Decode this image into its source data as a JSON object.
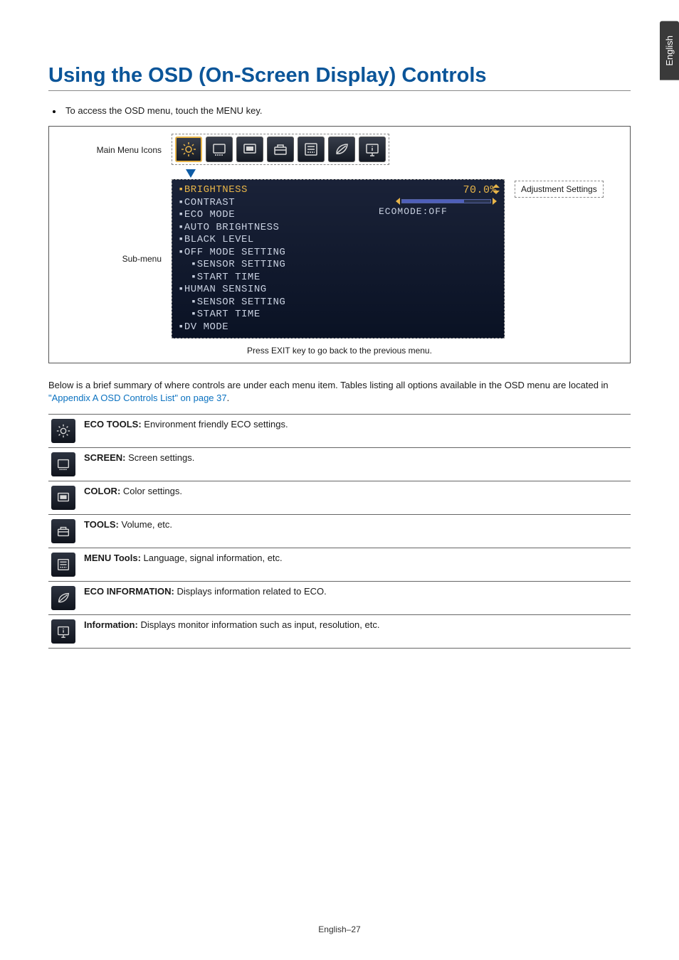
{
  "language_tab": "English",
  "page_title": "Using the OSD (On-Screen Display) Controls",
  "intro_bullet": "To access the OSD menu, touch the MENU key.",
  "diagram": {
    "main_icons_label": "Main Menu Icons",
    "sub_menu_label": "Sub-menu",
    "adjustment_label": "Adjustment Settings",
    "exit_text": "Press EXIT key to go back to the previous menu.",
    "brightness_value": "70.0%",
    "ecomode_text": "ECOMODE:OFF",
    "items": [
      {
        "text": "BRIGHTNESS",
        "indent": 0,
        "selected": true
      },
      {
        "text": "CONTRAST",
        "indent": 0,
        "selected": false
      },
      {
        "text": "ECO MODE",
        "indent": 0,
        "selected": false
      },
      {
        "text": "AUTO BRIGHTNESS",
        "indent": 0,
        "selected": false
      },
      {
        "text": "BLACK LEVEL",
        "indent": 0,
        "selected": false
      },
      {
        "text": "OFF MODE SETTING",
        "indent": 0,
        "selected": false
      },
      {
        "text": "SENSOR SETTING",
        "indent": 1,
        "selected": false
      },
      {
        "text": "START TIME",
        "indent": 1,
        "selected": false
      },
      {
        "text": "HUMAN SENSING",
        "indent": 0,
        "selected": false
      },
      {
        "text": "SENSOR SETTING",
        "indent": 1,
        "selected": false
      },
      {
        "text": "START TIME",
        "indent": 1,
        "selected": false
      },
      {
        "text": "DV MODE",
        "indent": 0,
        "selected": false
      }
    ]
  },
  "summary_text_before": "Below is a brief summary of where controls are under each menu item. Tables listing all options available in the OSD menu are located in ",
  "summary_link": "\"Appendix A OSD Controls List\" on page 37",
  "summary_text_after": ".",
  "menu_rows": [
    {
      "bold": "ECO TOOLS:",
      "text": " Environment friendly ECO settings.",
      "icon": "sun"
    },
    {
      "bold": "SCREEN:",
      "text": " Screen settings.",
      "icon": "screen"
    },
    {
      "bold": "COLOR:",
      "text": " Color settings.",
      "icon": "color"
    },
    {
      "bold": "TOOLS:",
      "text": " Volume, etc.",
      "icon": "toolbox"
    },
    {
      "bold": "MENU Tools:",
      "text": " Language, signal information, etc.",
      "icon": "menutools"
    },
    {
      "bold": "ECO INFORMATION:",
      "text": " Displays information related to ECO.",
      "icon": "leaf"
    },
    {
      "bold": "Information:",
      "text": " Displays monitor information such as input, resolution, etc.",
      "icon": "info"
    }
  ],
  "page_footer": "English–27",
  "icon_bar_names": [
    "sun",
    "screen",
    "color",
    "toolbox",
    "menutools",
    "leaf",
    "info"
  ]
}
